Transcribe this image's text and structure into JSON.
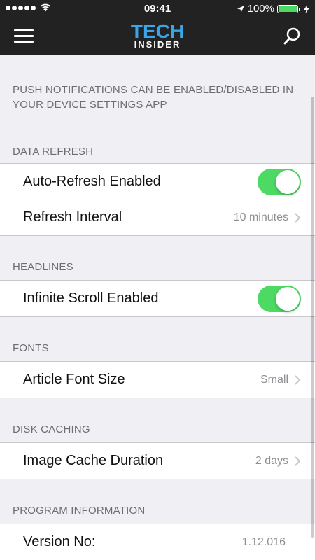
{
  "status_bar": {
    "time": "09:41",
    "battery_label": "100%",
    "battery_level": 1.0,
    "signal_icon": "signal-dots-icon",
    "wifi_icon": "wifi-icon",
    "location_icon": "location-arrow-icon",
    "charging_icon": "bolt-icon"
  },
  "nav": {
    "logo_top": "TECH",
    "logo_bottom": "INSIDER",
    "menu_icon": "hamburger-menu-icon",
    "search_icon": "search-icon",
    "logo_color": "#3aa6e8"
  },
  "note": "PUSH NOTIFICATIONS CAN BE ENABLED/DISABLED IN YOUR DEVICE SETTINGS APP",
  "sections": {
    "data_refresh": {
      "header": "DATA REFRESH",
      "auto_refresh_label": "Auto-Refresh Enabled",
      "auto_refresh_on": true,
      "refresh_interval_label": "Refresh Interval",
      "refresh_interval_value": "10 minutes"
    },
    "headlines": {
      "header": "HEADLINES",
      "infinite_scroll_label": "Infinite Scroll Enabled",
      "infinite_scroll_on": true
    },
    "fonts": {
      "header": "FONTS",
      "article_font_size_label": "Article Font Size",
      "article_font_size_value": "Small"
    },
    "disk_caching": {
      "header": "DISK CACHING",
      "image_cache_label": "Image Cache Duration",
      "image_cache_value": "2 days"
    },
    "program_information": {
      "header": "PROGRAM INFORMATION",
      "version_label": "Version No:",
      "version_value": "1.12.016"
    }
  },
  "colors": {
    "toggle_on": "#4cd964",
    "nav_background": "#222222",
    "page_background": "#efeff4"
  }
}
